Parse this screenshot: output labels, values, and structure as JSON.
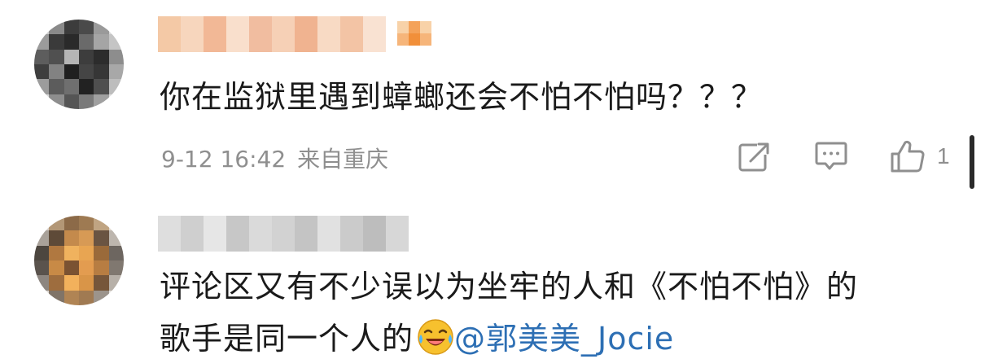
{
  "comments": [
    {
      "text": "你在监狱里遇到蟑螂还会不怕不怕吗？？？",
      "timestamp": "9-12 16:42",
      "location": "来自重庆",
      "likes": "1",
      "avatar_icon": "pixelated-avatar-icon",
      "username_blurred": true,
      "has_vip_badge": true
    },
    {
      "text_line1": "评论区又有不少误以为坐牢的人和《不怕不怕》的",
      "text_line2": "歌手是同一个人的",
      "emoji": "laughing-crying-emoji",
      "mention": "@郭美美_Jocie",
      "avatar_icon": "pixelated-avatar-icon",
      "username_blurred": true
    }
  ],
  "icons": {
    "share": "share-icon",
    "reply": "reply-icon",
    "like": "like-icon"
  },
  "colors": {
    "text": "#1a1a1a",
    "meta": "#8f8f8f",
    "mention": "#2d6fb4",
    "badge": "#f5a04a"
  }
}
